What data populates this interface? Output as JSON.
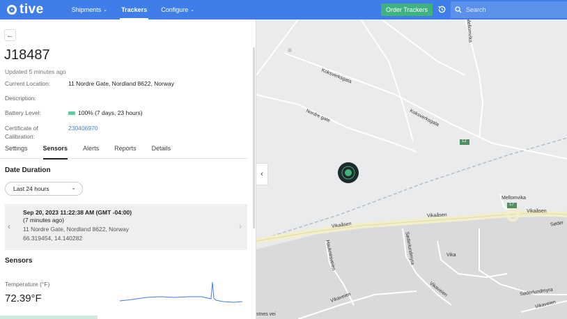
{
  "brand": {
    "name": "tive"
  },
  "nav": {
    "items": [
      {
        "label": "Shipments",
        "dropdown": true
      },
      {
        "label": "Trackers",
        "dropdown": false,
        "active": true
      },
      {
        "label": "Configure",
        "dropdown": true
      }
    ],
    "order_button": "Order Trackers",
    "search_placeholder": "Search"
  },
  "tracker": {
    "id": "J18487",
    "updated": "Updated 5 minutes ago",
    "fields": {
      "current_location_label": "Current Location:",
      "current_location_value": "11 Nordre Gate, Nordland 8622, Norway",
      "description_label": "Description:",
      "battery_label": "Battery Level:",
      "battery_value": "100% (7 days, 23 hours)",
      "certificate_label_1": "Certificate of",
      "certificate_label_2": "Calibration:",
      "certificate_value": "230406970"
    }
  },
  "tabs": [
    "Settings",
    "Sensors",
    "Alerts",
    "Reports",
    "Details"
  ],
  "active_tab": "Sensors",
  "date_duration": {
    "heading": "Date Duration",
    "selected": "Last 24 hours"
  },
  "location_card": {
    "timestamp": "Sep 20, 2023 11:22:38 AM (GMT -04:00)",
    "ago": "(7 minutes ago)",
    "address": "11 Nordre Gate, Nordland 8622, Norway",
    "coords": "66.319454, 14.140282"
  },
  "sensors": {
    "heading": "Sensors",
    "temperature_label": "Temperature (°F)",
    "temperature_value": "72.39°F"
  },
  "map": {
    "labels": {
      "kokverksgata_1": "Koksverksgata",
      "kokverksgata_2": "Koksverksgata",
      "nordre_gate": "Nordre gate",
      "mellomvika_top": "Mellomvika",
      "mellomvika": "Mellomvika",
      "vikaasen_1": "Vikaåsen",
      "vikaasen_2": "Vikaåsen",
      "vikaasen_3": "Vikaåsen",
      "hauknesveien": "Hauknesveien",
      "soderlundmyra_1": "Søderlundmyra",
      "soderlundmyra_2": "Søderlundmyra",
      "soder": "Søder",
      "vika": "Vika",
      "vikaveien_1": "Vikaveien",
      "vikaveien_2": "Vikaveien",
      "vikaveien_3": "Vikaveien",
      "stnes_vei": "stnes vei",
      "route_12": "12",
      "route_17": "17"
    },
    "accent": "#3fb27f"
  },
  "colors": {
    "nav_blue": "#3f7ee8",
    "green": "#3fb27f",
    "link": "#3f7ee8"
  }
}
